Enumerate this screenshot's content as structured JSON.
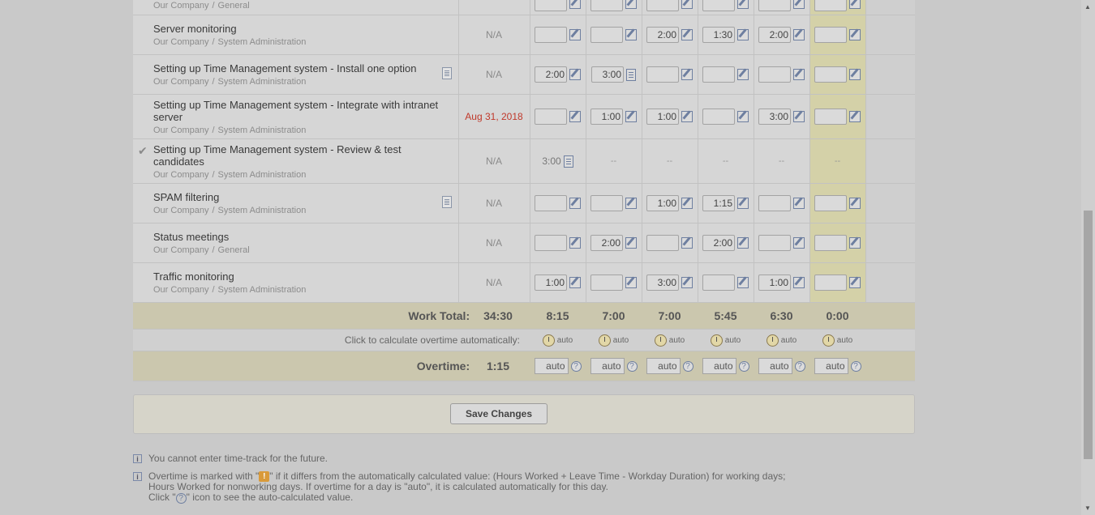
{
  "rows": [
    {
      "title": "",
      "company": "Our Company",
      "project": "General",
      "date": "",
      "cells": [
        "",
        "",
        "",
        "",
        "",
        ""
      ]
    },
    {
      "title": "Server monitoring",
      "company": "Our Company",
      "project": "System Administration",
      "date": "N/A",
      "cells": [
        "",
        "",
        "2:00",
        "1:30",
        "2:00",
        ""
      ]
    },
    {
      "title": "Setting up Time Management system - Install one option",
      "company": "Our Company",
      "project": "System Administration",
      "date": "N/A",
      "cells": [
        "2:00",
        "3:00",
        "",
        "",
        "",
        ""
      ]
    },
    {
      "title": "Setting up Time Management system - Integrate with intranet server",
      "company": "Our Company",
      "project": "System Administration",
      "date": "Aug 31, 2018",
      "cells": [
        "",
        "1:00",
        "1:00",
        "",
        "3:00",
        ""
      ]
    },
    {
      "title": "Setting up Time Management system - Review & test candidates",
      "company": "Our Company",
      "project": "System Administration",
      "date": "N/A",
      "closed_value": "3:00",
      "dash": "--"
    },
    {
      "title": "SPAM filtering",
      "company": "Our Company",
      "project": "System Administration",
      "date": "N/A",
      "cells": [
        "",
        "",
        "1:00",
        "1:15",
        "",
        ""
      ]
    },
    {
      "title": "Status meetings",
      "company": "Our Company",
      "project": "General",
      "date": "N/A",
      "cells": [
        "",
        "2:00",
        "",
        "2:00",
        "",
        ""
      ]
    },
    {
      "title": "Traffic monitoring",
      "company": "Our Company",
      "project": "System Administration",
      "date": "N/A",
      "cells": [
        "1:00",
        "",
        "3:00",
        "",
        "1:00",
        ""
      ]
    }
  ],
  "path_separator": "/",
  "work_total": {
    "label": "Work Total:",
    "value": "34:30",
    "days": [
      "8:15",
      "7:00",
      "7:00",
      "5:45",
      "6:30",
      "0:00"
    ]
  },
  "auto_calc": {
    "label": "Click to calculate overtime automatically:",
    "link": "auto"
  },
  "overtime": {
    "label": "Overtime:",
    "value": "1:15",
    "days": [
      "auto",
      "auto",
      "auto",
      "auto",
      "auto",
      "auto"
    ]
  },
  "save_label": "Save Changes",
  "notes": {
    "future": "You cannot enter time-track for the future.",
    "ot_part1": "Overtime is marked with \"",
    "ot_part2": "\" if it differs from the automatically calculated value: (Hours Worked + Leave Time - Workday Duration) for working days;",
    "ot_line2": "Hours Worked for nonworking days. If overtime for a day is \"auto\", it is calculated automatically for this day.",
    "click_part1": "Click \"",
    "click_part2": "\" icon to see the auto-calculated value.",
    "warn_glyph": "!",
    "help_glyph": "?",
    "info_glyph": "i"
  },
  "colors": {
    "today_column": "#d4d1a8",
    "overdue_date": "#c0392b",
    "total_band": "#cbc7ae"
  }
}
